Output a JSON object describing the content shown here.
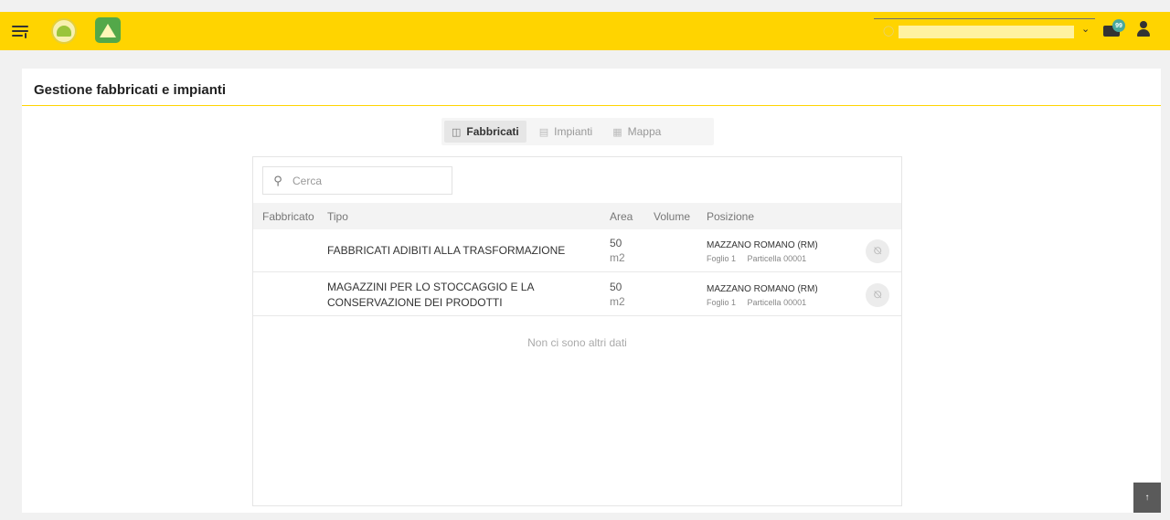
{
  "app": {
    "page_title": "Gestione fabbricati e impianti",
    "brand_color": "#ffd400"
  },
  "header": {
    "menu_icon": "hamburger-menu-icon",
    "notifications_badge": "99",
    "user_select_value": ""
  },
  "tabs": [
    {
      "label": "Fabbricati",
      "icon": "building-icon",
      "active": true
    },
    {
      "label": "Impianti",
      "icon": "folder-icon",
      "active": false
    },
    {
      "label": "Mappa",
      "icon": "map-icon",
      "active": false
    }
  ],
  "search": {
    "placeholder": "Cerca",
    "value": ""
  },
  "table": {
    "columns": [
      "Fabbricato",
      "Tipo",
      "Area",
      "Volume",
      "Posizione"
    ],
    "rows": [
      {
        "fabbricato": "",
        "tipo": "FABBRICATI ADIBITI ALLA TRASFORMAZIONE",
        "area_value": "50",
        "area_unit": "m2",
        "volume": "",
        "posizione_comune": "MAZZANO ROMANO (RM)",
        "posizione_foglio": "Foglio 1",
        "posizione_particella": "Particella 00001"
      },
      {
        "fabbricato": "",
        "tipo": "MAGAZZINI PER LO STOCCAGGIO E LA CONSERVAZIONE DEI PRODOTTI",
        "area_value": "50",
        "area_unit": "m2",
        "volume": "",
        "posizione_comune": "MAZZANO ROMANO (RM)",
        "posizione_foglio": "Foglio 1",
        "posizione_particella": "Particella 00001"
      }
    ],
    "empty_message": "Non ci sono altri dati"
  }
}
